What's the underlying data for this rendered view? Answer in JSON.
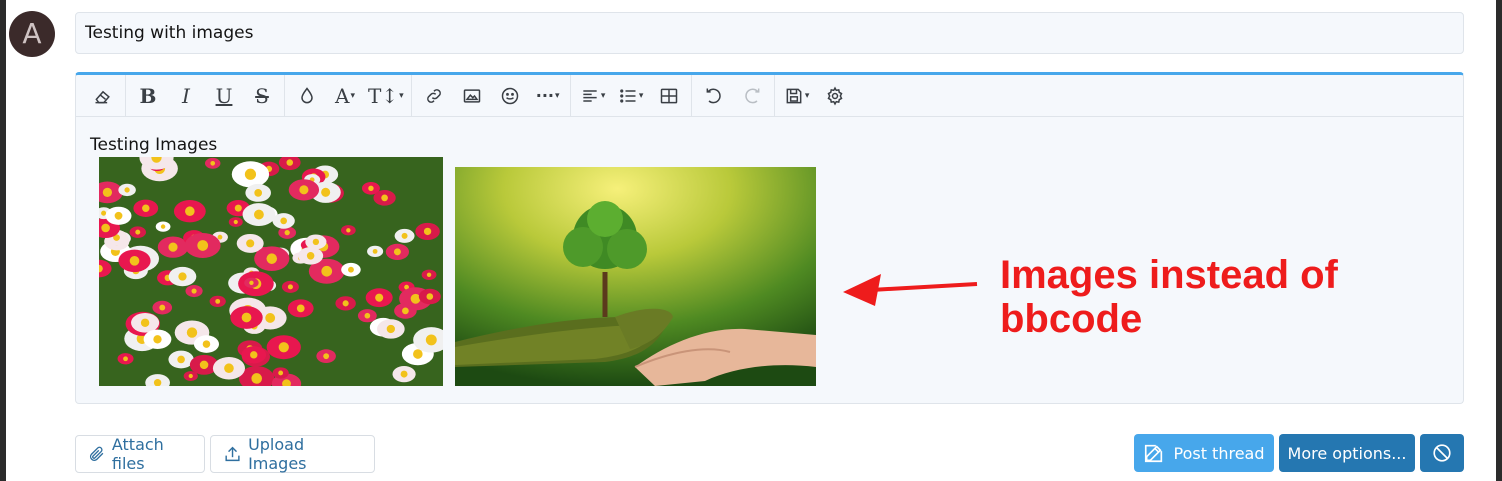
{
  "user": {
    "avatar_letter": "A"
  },
  "thread": {
    "title_value": "Testing with images"
  },
  "toolbar": {
    "icons": [
      "eraser-icon",
      "bold-icon",
      "italic-icon",
      "underline-icon",
      "strikethrough-icon",
      "text-color-icon",
      "font-family-icon",
      "font-size-icon",
      "link-icon",
      "image-icon",
      "emoji-icon",
      "more-icon",
      "align-icon",
      "list-icon",
      "table-icon",
      "undo-icon",
      "redo-icon",
      "drafts-icon",
      "settings-icon"
    ],
    "bold_glyph": "B",
    "italic_glyph": "I",
    "underline_glyph": "U",
    "strike_glyph": "S",
    "font_glyph": "A",
    "size_glyph": "T↕",
    "more_glyph": "···",
    "caret": "▾"
  },
  "editor": {
    "text": "Testing Images"
  },
  "annotation": {
    "line1": "Images instead of",
    "line2": "bbcode",
    "color": "#ee1c1c"
  },
  "actions": {
    "attach_label": "Attach files",
    "upload_label": "Upload Images",
    "post_label": "Post thread",
    "more_label": "More options..."
  },
  "colors": {
    "accent": "#47a7eb",
    "post_button": "#47a7eb",
    "more_button": "#2577b1",
    "cancel_button": "#2577b1"
  }
}
